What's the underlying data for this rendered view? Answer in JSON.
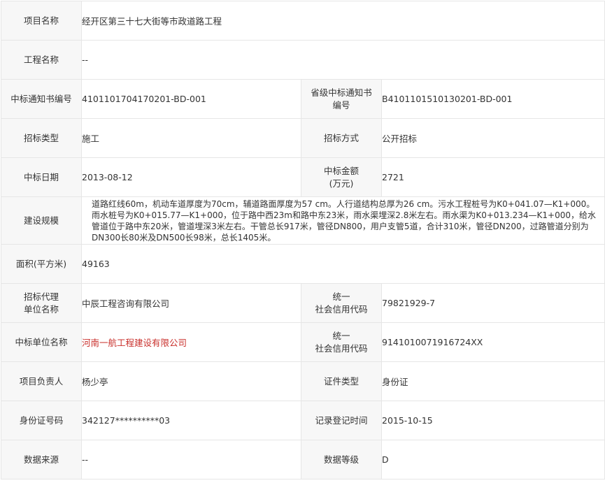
{
  "rows": {
    "project_name": {
      "label": "项目名称",
      "value": "经开区第三十七大街等市政道路工程"
    },
    "engineering_name": {
      "label": "工程名称",
      "value": "--"
    },
    "notice_no": {
      "label": "中标通知书编号",
      "value": "4101101704170201-BD-001",
      "label2": "省级中标通知书\n编号",
      "value2": "B4101101510130201-BD-001"
    },
    "bid_type": {
      "label": "招标类型",
      "value": "施工",
      "label2": "招标方式",
      "value2": "公开招标"
    },
    "bid_date": {
      "label": "中标日期",
      "value": "2013-08-12",
      "label2": "中标金额\n(万元)",
      "value2": "2721"
    },
    "scale": {
      "label": "建设规模",
      "value": "道路红线60m，机动车道厚度为70cm，辅道路面厚度为57 cm。人行道结构总厚为26 cm。污水工程桩号为K0+041.07—K1+000。雨水桩号为K0+015.77—K1+000，位于路中西23m和路中东23米，雨水渠埋深2.8米左右。雨水渠为K0+013.234—K1+000，给水管道位于路中东20米，管道埋深3米左右。干管总长917米，管径DN800，用户支管5道，合计310米，管径DN200，过路管道分别为DN300长80米及DN500长98米，总长1405米。"
    },
    "area": {
      "label": "面积(平方米)",
      "value": "49163"
    },
    "agency": {
      "label": "招标代理\n单位名称",
      "value": "中辰工程咨询有限公司",
      "label2": "统一\n社会信用代码",
      "value2": "79821929-7"
    },
    "winner": {
      "label": "中标单位名称",
      "value": "河南一航工程建设有限公司",
      "label2": "统一\n社会信用代码",
      "value2": "9141010071916724XX"
    },
    "manager": {
      "label": "项目负责人",
      "value": "杨少亭",
      "label2": "证件类型",
      "value2": "身份证"
    },
    "id_no": {
      "label": "身份证号码",
      "value": "342127**********03",
      "label2": "记录登记时间",
      "value2": "2015-10-15"
    },
    "source": {
      "label": "数据来源",
      "value": "--",
      "label2": "数据等级",
      "value2": "D"
    }
  },
  "colors": {
    "label_bg": "#f7f7f7",
    "border": "#e6e6e6",
    "text": "#333333",
    "link_red": "#c9302c"
  }
}
